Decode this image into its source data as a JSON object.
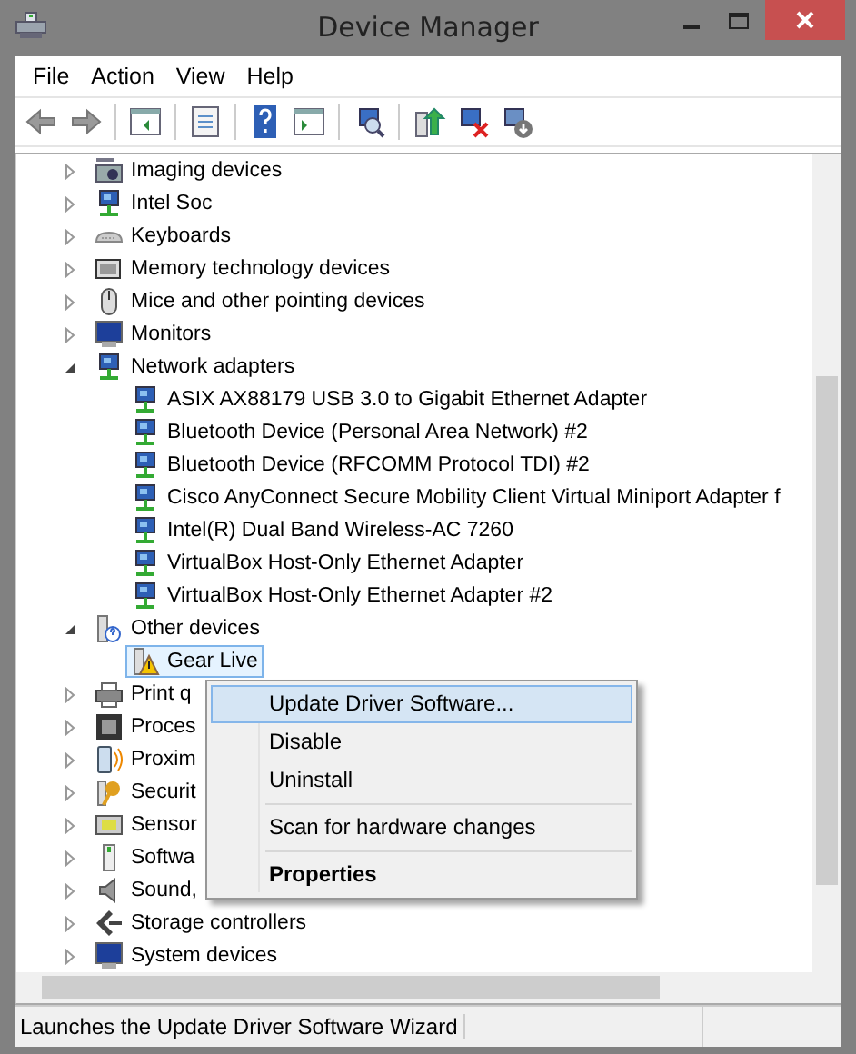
{
  "window": {
    "title": "Device Manager"
  },
  "menu_bar": [
    "File",
    "Action",
    "View",
    "Help"
  ],
  "tree": [
    {
      "label": "Imaging devices",
      "expanded": false,
      "selected": false
    },
    {
      "label": "Intel Soc",
      "expanded": false,
      "selected": false
    },
    {
      "label": "Keyboards",
      "expanded": false,
      "selected": false
    },
    {
      "label": "Memory technology devices",
      "expanded": false,
      "selected": false
    },
    {
      "label": "Mice and other pointing devices",
      "expanded": false,
      "selected": false
    },
    {
      "label": "Monitors",
      "expanded": false,
      "selected": false
    },
    {
      "label": "Network adapters",
      "expanded": true,
      "selected": false,
      "children": [
        {
          "label": "ASIX AX88179 USB 3.0 to Gigabit Ethernet Adapter",
          "selected": false
        },
        {
          "label": "Bluetooth Device (Personal Area Network) #2",
          "selected": false
        },
        {
          "label": "Bluetooth Device (RFCOMM Protocol TDI) #2",
          "selected": false
        },
        {
          "label": "Cisco AnyConnect Secure Mobility Client Virtual Miniport Adapter f",
          "selected": false
        },
        {
          "label": "Intel(R) Dual Band Wireless-AC 7260",
          "selected": false
        },
        {
          "label": "VirtualBox Host-Only Ethernet Adapter",
          "selected": false
        },
        {
          "label": "VirtualBox Host-Only Ethernet Adapter #2",
          "selected": false
        }
      ]
    },
    {
      "label": "Other devices",
      "expanded": true,
      "selected": false,
      "children": [
        {
          "label": "Gear Live",
          "selected": true
        }
      ]
    },
    {
      "label": "Print q",
      "expanded": false,
      "selected": false
    },
    {
      "label": "Proces",
      "expanded": false,
      "selected": false
    },
    {
      "label": "Proxim",
      "expanded": false,
      "selected": false
    },
    {
      "label": "Securit",
      "expanded": false,
      "selected": false
    },
    {
      "label": "Sensor",
      "expanded": false,
      "selected": false
    },
    {
      "label": "Softwa",
      "expanded": false,
      "selected": false
    },
    {
      "label": "Sound,",
      "expanded": false,
      "selected": false
    },
    {
      "label": "Storage controllers",
      "expanded": false,
      "selected": false
    },
    {
      "label": "System devices",
      "expanded": false,
      "selected": false
    }
  ],
  "context_menu": {
    "groups": [
      [
        {
          "label": "Update Driver Software...",
          "selected": true,
          "kind": "item"
        },
        {
          "label": "Disable",
          "selected": false,
          "kind": "item"
        },
        {
          "label": "Uninstall",
          "selected": false,
          "kind": "item"
        }
      ],
      [
        {
          "label": "Scan for hardware changes",
          "selected": false,
          "kind": "item"
        }
      ],
      [
        {
          "label": "Properties",
          "selected": false,
          "kind": "default"
        }
      ]
    ]
  },
  "status_bar": "Launches the Update Driver Software Wizard"
}
